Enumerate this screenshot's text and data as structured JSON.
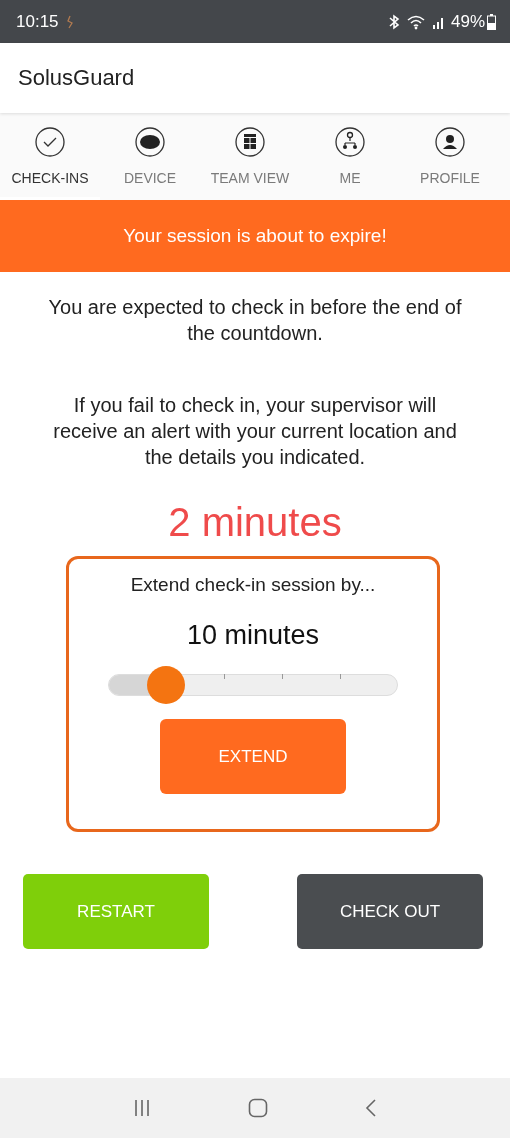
{
  "status_bar": {
    "time": "10:15",
    "battery": "49%"
  },
  "app_bar": {
    "title": "SolusGuard"
  },
  "tabs": [
    {
      "label": "CHECK-INS",
      "selected": true
    },
    {
      "label": "DEVICE",
      "selected": false
    },
    {
      "label": "TEAM VIEW",
      "selected": false
    },
    {
      "label": "ME",
      "selected": false
    },
    {
      "label": "PROFILE",
      "selected": false
    }
  ],
  "banner": "Your session is about to expire!",
  "messages": [
    "You are expected to check in before the end of the countdown.",
    "If you fail to check in, your supervisor will receive an alert with your current location and the details you indicated."
  ],
  "countdown": "2 minutes",
  "extend_card": {
    "prompt": "Extend check-in session by...",
    "value": "10 minutes",
    "level": 0.2,
    "button": "EXTEND"
  },
  "actions": [
    {
      "label": "RESTART",
      "kind": "restart"
    },
    {
      "label": "CHECK OUT",
      "kind": "checkout"
    }
  ]
}
